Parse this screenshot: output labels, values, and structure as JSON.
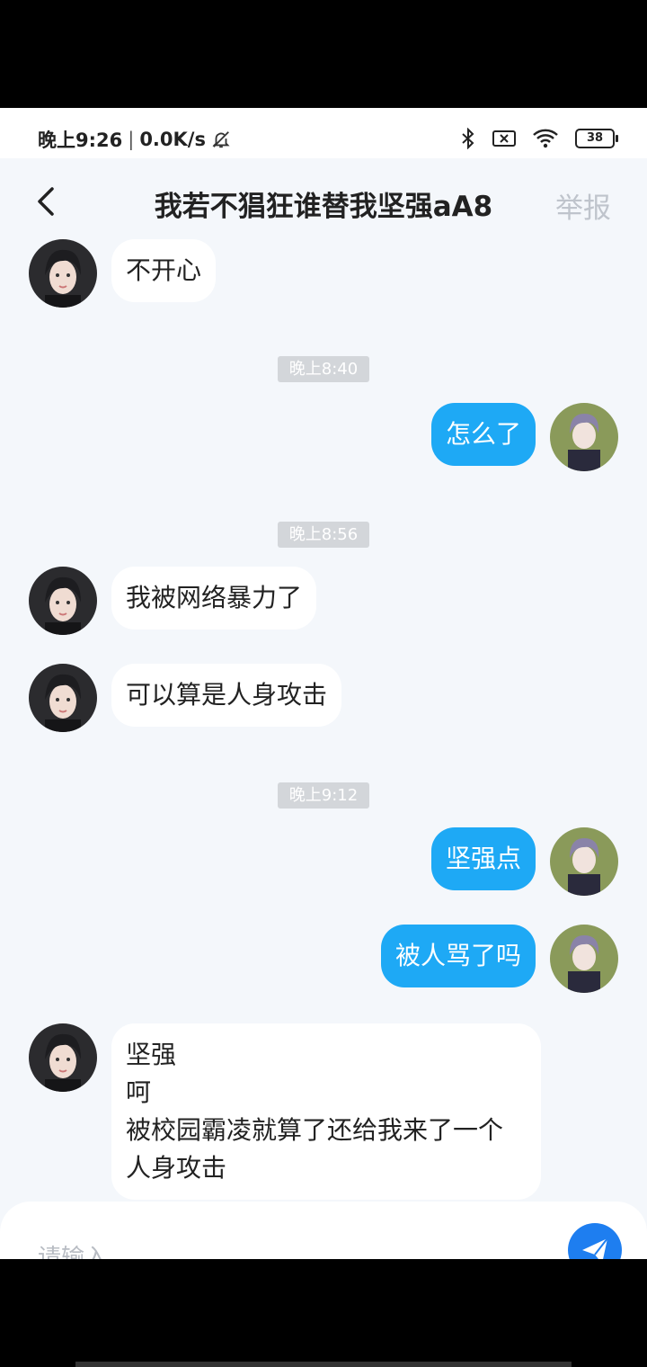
{
  "status_bar": {
    "time": "晚上9:26",
    "network_speed": "0.0K/s",
    "battery": "38"
  },
  "header": {
    "back_icon": "chevron-left-icon",
    "title": "我若不猖狂谁替我坚强aA8",
    "report_label": "举报"
  },
  "messages": [
    {
      "sender": "other",
      "text": "不开心"
    },
    {
      "type": "time",
      "text": "晚上8:40"
    },
    {
      "sender": "me",
      "text": "怎么了"
    },
    {
      "type": "time",
      "text": "晚上8:56"
    },
    {
      "sender": "other",
      "text": "我被网络暴力了"
    },
    {
      "sender": "other",
      "text": "可以算是人身攻击"
    },
    {
      "type": "time",
      "text": "晚上9:12"
    },
    {
      "sender": "me",
      "text": "坚强点"
    },
    {
      "sender": "me",
      "text": "被人骂了吗"
    },
    {
      "sender": "other",
      "lines": [
        "坚强",
        "呵",
        "被校园霸凌就算了还给我来了一个人身攻击"
      ]
    }
  ],
  "input": {
    "placeholder": "请输入..."
  },
  "colors": {
    "my_bubble": "#1ea9f5",
    "other_bubble": "#ffffff",
    "background": "#f4f7fb",
    "send_button": "#1e7ef0",
    "report_text": "#bfc4cc"
  }
}
